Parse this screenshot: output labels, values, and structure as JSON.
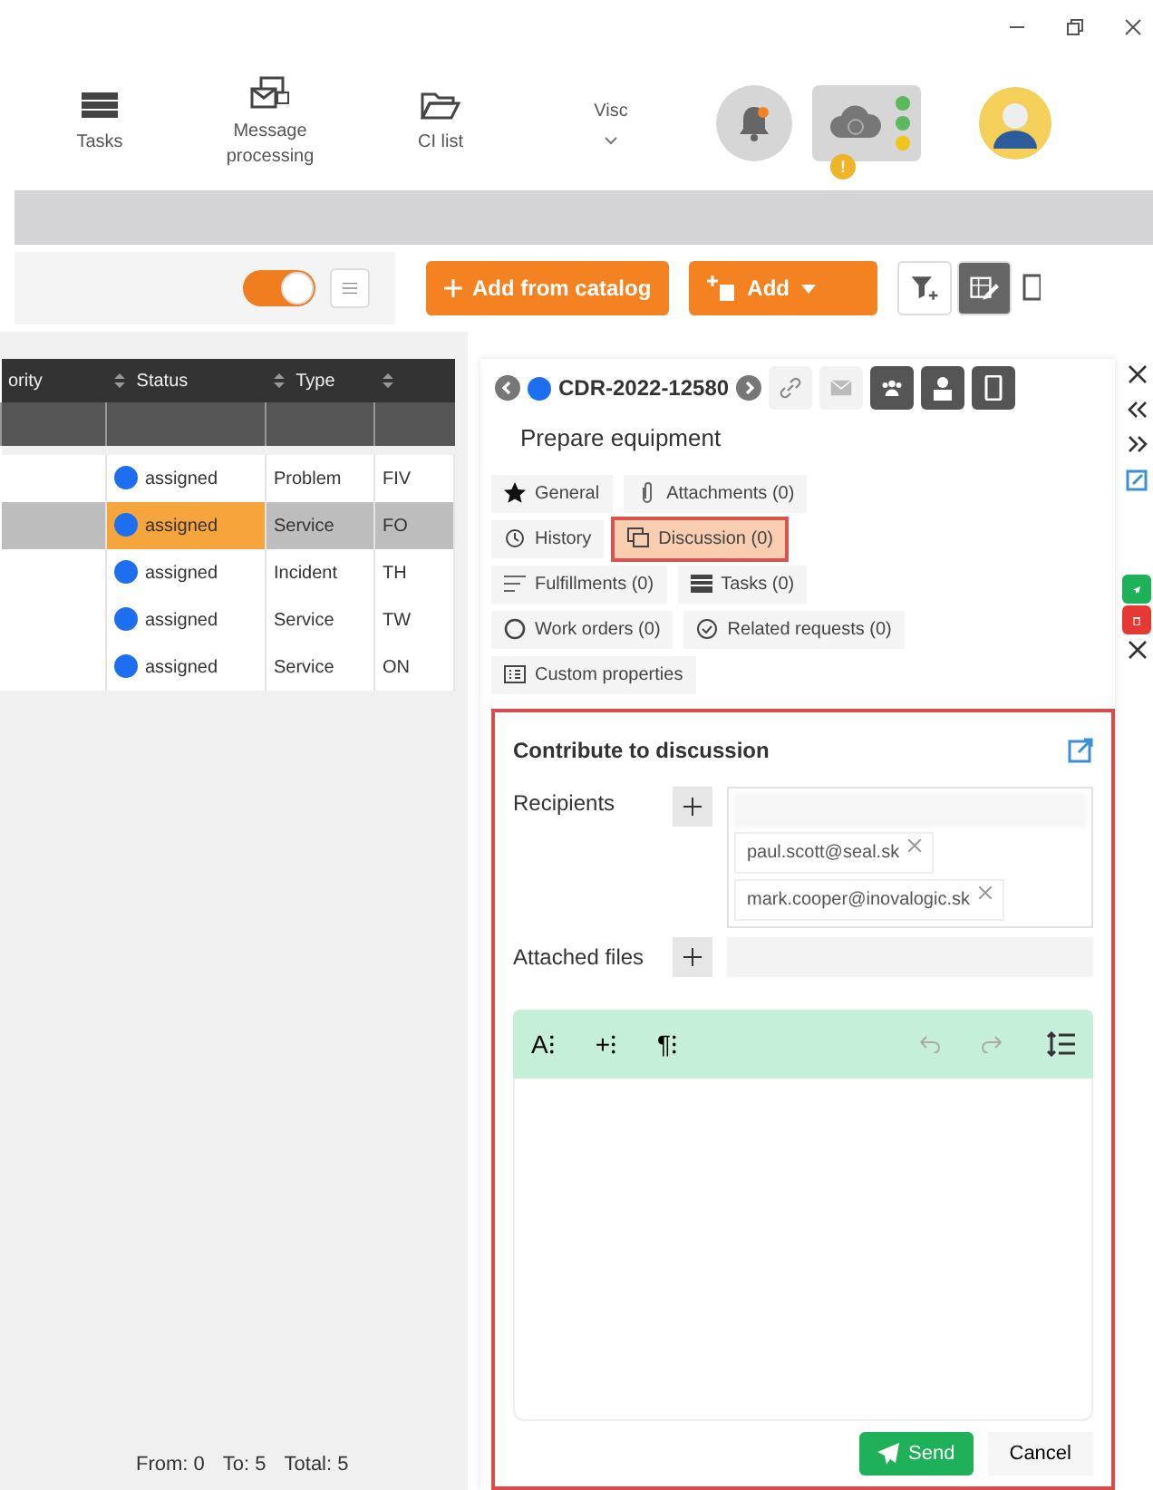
{
  "nav": {
    "items": [
      {
        "label": "Tasks"
      },
      {
        "label": "Message processing"
      },
      {
        "label": "CI list"
      },
      {
        "label": "Visc"
      }
    ],
    "cloud_badge": "!",
    "status_lights": [
      {
        "color": "#5cb85c"
      },
      {
        "color": "#5cb85c"
      },
      {
        "color": "#f0c419"
      }
    ]
  },
  "toolbar": {
    "filter_toggle": {
      "on": true
    },
    "add_from_catalog": "Add from catalog",
    "add": "Add"
  },
  "table": {
    "columns": [
      {
        "label": "ority"
      },
      {
        "label": "Status"
      },
      {
        "label": "Type"
      }
    ],
    "rows": [
      {
        "status": "assigned",
        "color": "#1e6ff0",
        "type": "Problem",
        "column_4": "FIV",
        "selected": false
      },
      {
        "status": "assigned",
        "color": "#1e6ff0",
        "type": "Service",
        "column_4": "FO",
        "selected": true
      },
      {
        "status": "assigned",
        "color": "#1e6ff0",
        "type": "Incident",
        "column_4": "TH",
        "selected": false
      },
      {
        "status": "assigned",
        "color": "#1e6ff0",
        "type": "Service",
        "column_4": "TW",
        "selected": false
      },
      {
        "status": "assigned",
        "color": "#1e6ff0",
        "type": "Service",
        "column_4": "ON",
        "selected": false
      }
    ],
    "footer": [
      "From: 0",
      "To: 5",
      "Total: 5"
    ]
  },
  "detail": {
    "id": "CDR-2022-12580",
    "status_dot": {
      "color": "#1e6ff0"
    },
    "title": "Prepare equipment",
    "tab_rows": [
      [
        {
          "label": "General",
          "selected": false
        },
        {
          "label": "Attachments (0)",
          "selected": false
        }
      ],
      [
        {
          "label": "History",
          "selected": false
        },
        {
          "label": "Discussion (0)",
          "selected": true
        }
      ],
      [
        {
          "label": "Fulfillments (0)",
          "selected": false
        },
        {
          "label": "Tasks (0)",
          "selected": false
        }
      ],
      [
        {
          "label": "Work orders (0)",
          "selected": false
        },
        {
          "label": "Related requests (0)",
          "selected": false
        }
      ],
      [
        {
          "label": "Custom properties",
          "selected": false
        }
      ]
    ],
    "discussion": {
      "heading": "Contribute to discussion",
      "recipients_label": "Recipients",
      "recipients": [
        "paul.scott@seal.sk",
        "mark.cooper@inovalogic.sk"
      ],
      "attached_label": "Attached files",
      "editor_tools": [
        "A⁝",
        "+⁝",
        "¶⁝"
      ],
      "send": "Send",
      "cancel": "Cancel"
    }
  }
}
